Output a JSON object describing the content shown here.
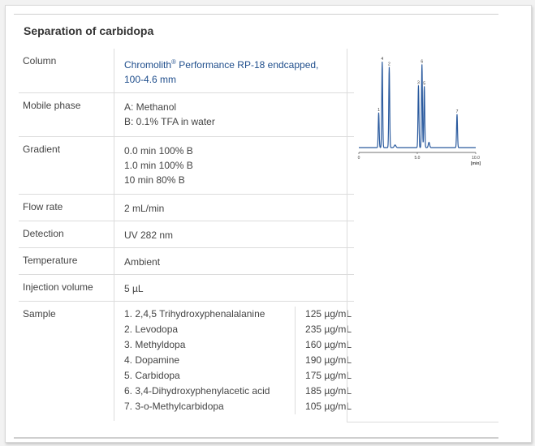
{
  "title": "Separation of carbidopa",
  "rows": {
    "column": {
      "label": "Column",
      "brand": "Chromolith",
      "reg": "®",
      "rest": " Performance RP-18 endcapped,",
      "line2": "100-4.6 mm"
    },
    "mobile_phase": {
      "label": "Mobile phase",
      "lines": [
        "A: Methanol",
        "B: 0.1% TFA in water"
      ]
    },
    "gradient": {
      "label": "Gradient",
      "lines": [
        "0.0 min 100% B",
        "1.0 min 100% B",
        "10 min 80% B"
      ]
    },
    "flow_rate": {
      "label": "Flow rate",
      "value": "2 mL/min"
    },
    "detection": {
      "label": "Detection",
      "value": "UV 282 nm"
    },
    "temperature": {
      "label": "Temperature",
      "value": "Ambient"
    },
    "injection_volume": {
      "label": "Injection volume",
      "value": "5 µL"
    },
    "sample": {
      "label": "Sample",
      "items": [
        {
          "name": "1. 2,4,5 Trihydroxyphenalalanine",
          "conc": "125 µg/mL"
        },
        {
          "name": "2. Levodopa",
          "conc": "235 µg/mL"
        },
        {
          "name": "3. Methyldopa",
          "conc": "160 µg/mL"
        },
        {
          "name": "4. Dopamine",
          "conc": "190 µg/mL"
        },
        {
          "name": "5. Carbidopa",
          "conc": "175 µg/mL"
        },
        {
          "name": "6. 3,4-Dihydroxyphenylacetic acid",
          "conc": "185 µg/mL"
        },
        {
          "name": "7. 3-o-Methylcarbidopa",
          "conc": "105 µg/mL"
        }
      ]
    }
  },
  "chart_data": {
    "type": "line",
    "xlim": [
      0,
      10
    ],
    "ylim": [
      0,
      1
    ],
    "xticks": [
      "0",
      "5.0",
      "10.0"
    ],
    "xunit": "[min]",
    "grid": false,
    "line_color": "#2a5a9e",
    "peaks": [
      {
        "label": "1",
        "rt": 1.7,
        "height": 0.4
      },
      {
        "label": "4",
        "rt": 2.0,
        "height": 0.98
      },
      {
        "label": "2",
        "rt": 2.6,
        "height": 0.92
      },
      {
        "label": "3",
        "rt": 5.1,
        "height": 0.71
      },
      {
        "label": "6",
        "rt": 5.4,
        "height": 0.95
      },
      {
        "label": "5",
        "rt": 5.6,
        "height": 0.7
      },
      {
        "label": "7",
        "rt": 8.4,
        "height": 0.38
      }
    ]
  }
}
